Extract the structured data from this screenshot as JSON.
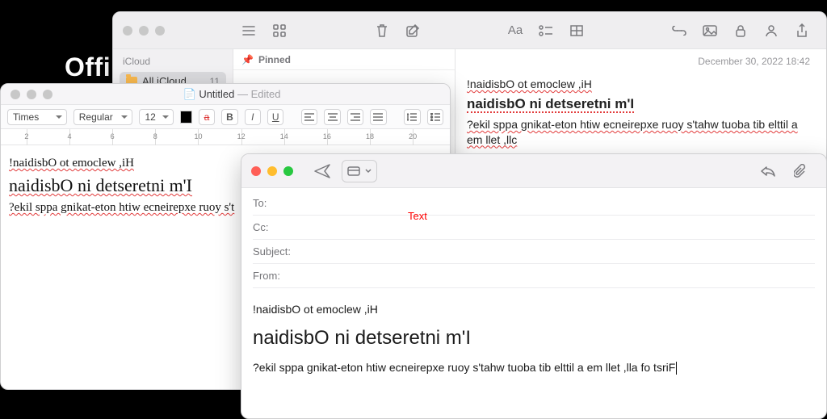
{
  "bg_text": "Offi",
  "notes": {
    "timestamp": "December 30, 2022 18:42",
    "sidebar": {
      "section": "iCloud",
      "item_label": "All iCloud",
      "count": "11"
    },
    "pinned_label": "Pinned",
    "line1": "!naidisbO ot emoclew ,iH",
    "line2": "naidisbO ni detseretni m'I",
    "line3": "?ekil sppa gnikat-eton htiw ecneirepxe ruoy s'tahw tuoba tib elttil a em llet ,llc"
  },
  "textedit": {
    "doc_icon": "📄",
    "title": "Untitled",
    "edited": " — Edited",
    "font_family": "Times",
    "font_style": "Regular",
    "font_size": "12",
    "ruler_nums": [
      "2",
      "4",
      "6",
      "8",
      "10",
      "12",
      "14",
      "16",
      "18",
      "20"
    ],
    "line1": "!naidisbO ot emoclew ,iH",
    "line2": "naidisbO ni detseretni m'I",
    "line3": "?ekil sppa gnikat-eton htiw ecneirepxe ruoy s't"
  },
  "compose": {
    "to_label": "To:",
    "cc_label": "Cc:",
    "subject_label": "Subject:",
    "from_label": "From:",
    "line1": "!naidisbO ot emoclew ,iH",
    "line2": "naidisbO ni detseretni m'I",
    "line3": "?ekil sppa gnikat-eton htiw ecneirepxe ruoy s'tahw tuoba tib elttil a em llet ,lla fo tsriF"
  },
  "red_caption": "Text"
}
